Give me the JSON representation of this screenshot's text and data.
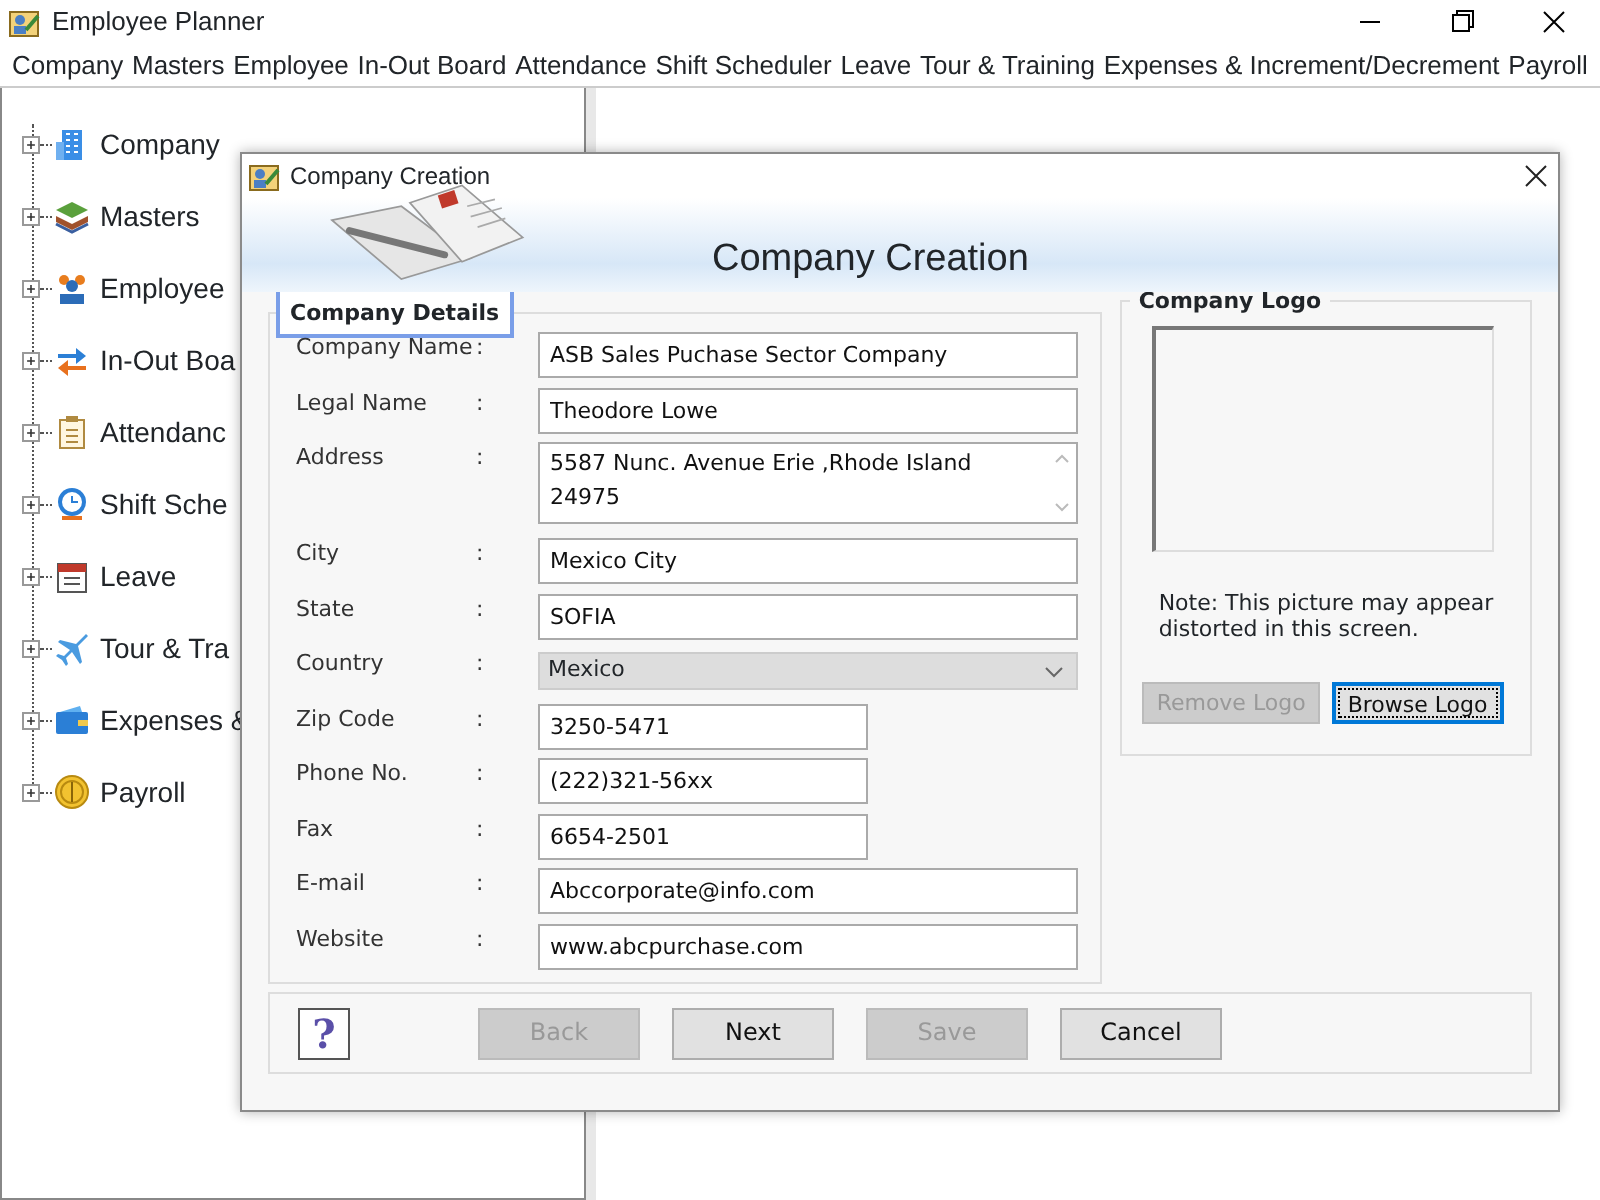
{
  "window": {
    "title": "Employee Planner"
  },
  "menu": [
    {
      "label": "Company"
    },
    {
      "label": "Masters"
    },
    {
      "label": "Employee"
    },
    {
      "label": "In-Out Board"
    },
    {
      "label": "Attendance"
    },
    {
      "label": "Shift Scheduler"
    },
    {
      "label": "Leave"
    },
    {
      "label": "Tour & Training"
    },
    {
      "label": "Expenses & Increment/Decrement"
    },
    {
      "label": "Payroll"
    }
  ],
  "tree": [
    {
      "label": "Company",
      "expanded": false
    },
    {
      "label": "Masters",
      "expanded": false
    },
    {
      "label": "Employee",
      "expanded": false
    },
    {
      "label": "In-Out Boa",
      "expanded": false
    },
    {
      "label": "Attendanc",
      "expanded": false
    },
    {
      "label": "Shift Sche",
      "expanded": false
    },
    {
      "label": "Leave",
      "expanded": false
    },
    {
      "label": "Tour & Tra",
      "expanded": false
    },
    {
      "label": "Expenses &",
      "expanded": false
    },
    {
      "label": "Payroll",
      "expanded": false
    }
  ],
  "dialog": {
    "title": "Company Creation",
    "heading": "Company Creation",
    "details": {
      "legend": "Company Details",
      "fields": [
        {
          "label": "Company Name",
          "colon": ":",
          "kind": "text",
          "value": "ASB Sales Puchase Sector Company"
        },
        {
          "label": "Legal Name",
          "colon": ":",
          "kind": "text",
          "value": "Theodore Lowe"
        },
        {
          "label": "Address",
          "colon": ":",
          "kind": "multiline",
          "value": "5587 Nunc. Avenue Erie ,Rhode Island 24975"
        },
        {
          "label": "City",
          "colon": ":",
          "kind": "text",
          "value": "Mexico City"
        },
        {
          "label": "State",
          "colon": ":",
          "kind": "text",
          "value": "SOFIA"
        },
        {
          "label": "Country",
          "colon": ":",
          "kind": "dropdown",
          "value": "Mexico"
        },
        {
          "label": "Zip Code",
          "colon": ":",
          "kind": "short",
          "value": "3250-5471"
        },
        {
          "label": "Phone No.",
          "colon": ":",
          "kind": "short",
          "value": "(222)321-56xx"
        },
        {
          "label": "Fax",
          "colon": ":",
          "kind": "short",
          "value": "6654-2501"
        },
        {
          "label": "E-mail",
          "colon": ":",
          "kind": "text",
          "value": "Abccorporate@info.com"
        },
        {
          "label": "Website",
          "colon": ":",
          "kind": "text",
          "value": "www.abcpurchase.com"
        }
      ]
    },
    "logo": {
      "legend": "Company Logo",
      "note": "Note: This picture may appear distorted in this screen.",
      "buttons": [
        {
          "label": "Remove Logo",
          "disabled": true,
          "focused": false
        },
        {
          "label": "Browse Logo",
          "disabled": false,
          "focused": true
        }
      ]
    },
    "help": "?",
    "buttons": [
      {
        "label": "Back",
        "disabled": true
      },
      {
        "label": "Next",
        "disabled": false
      },
      {
        "label": "Save",
        "disabled": true
      },
      {
        "label": "Cancel",
        "disabled": false
      }
    ]
  }
}
